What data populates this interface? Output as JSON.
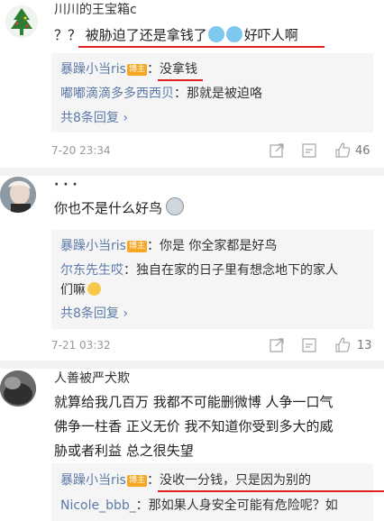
{
  "comments": [
    {
      "username": "川川的王宝箱c",
      "text": "？？ 被胁迫了还是拿钱了",
      "text_tail": "好吓人啊",
      "replies": [
        {
          "name": "暴躁小当ris",
          "badge": "博主",
          "sep": "：",
          "text": "没拿钱"
        },
        {
          "name": "嘟嘟滴滴多多西西贝",
          "badge": "",
          "sep": "：",
          "text": "那就是被迫咯"
        }
      ],
      "more": "共8条回复 ›",
      "time": "7-20 23:34",
      "likes": "46"
    },
    {
      "username": "· · ·",
      "text": "你也不是什么好鸟",
      "replies": [
        {
          "name": "暴躁小当ris",
          "badge": "博主",
          "sep": "：",
          "text": "你是 你全家都是好鸟"
        },
        {
          "name": "尔东先生哎",
          "badge": "",
          "sep": "：",
          "text": "独自在家的日子里有想念地下的家人",
          "text2": "们嘛"
        }
      ],
      "more": "共8条回复 ›",
      "time": "7-21 03:32",
      "likes": "13"
    },
    {
      "username": "人善被严犬欺",
      "text_lines": [
        "就算给我几百万 我都不可能删微博 人争一口气",
        "佛争一柱香 正义无价 我不知道你受到多大的威",
        "胁或者利益 总之很失望"
      ],
      "replies": [
        {
          "name": "暴躁小当ris",
          "badge": "博主",
          "sep": "：",
          "text": "没收一分钱，只是因为别的"
        },
        {
          "name": "Nicole_bbb_",
          "badge": "",
          "sep": "：",
          "text": "那如果人身安全可能有危险呢？如"
        }
      ]
    }
  ],
  "colors": {
    "link": "#5b7aa8",
    "highlight": "#e02020",
    "badge": "#f5a623",
    "meta": "#999999"
  }
}
